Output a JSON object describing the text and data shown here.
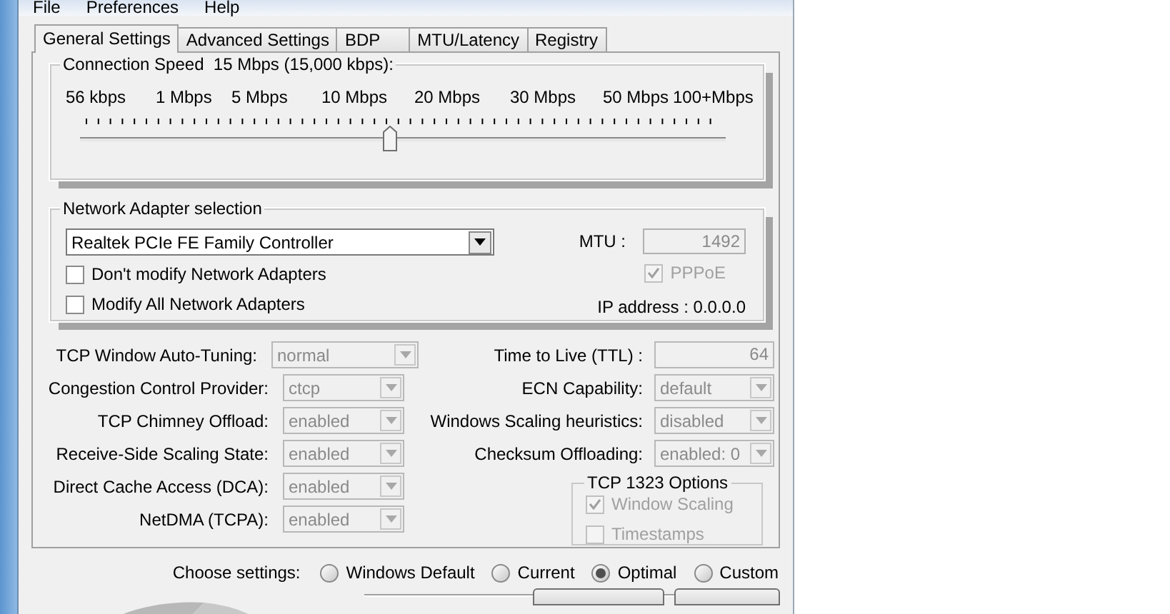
{
  "menu": [
    "File",
    "Preferences",
    "Help"
  ],
  "tabs": [
    {
      "label": "General Settings",
      "selected": true
    },
    {
      "label": "Advanced Settings",
      "selected": false
    },
    {
      "label": "BDP",
      "selected": false
    },
    {
      "label": "MTU/Latency",
      "selected": false
    },
    {
      "label": "Registry",
      "selected": false
    }
  ],
  "connection_speed": {
    "title": "Connection Speed",
    "value": "15 Mbps (15,000 kbps):",
    "scale": [
      "56 kbps",
      "1 Mbps",
      "5 Mbps",
      "10 Mbps",
      "20 Mbps",
      "30 Mbps",
      "50 Mbps",
      "100+Mbps"
    ],
    "level": 0.48
  },
  "adapter": {
    "title": "Network Adapter selection",
    "selected_adapter": "Realtek PCIe FE Family Controller",
    "options": [
      {
        "label": "Don't modify Network Adapters",
        "checked": false
      },
      {
        "label": "Modify All Network Adapters",
        "checked": false
      }
    ],
    "mtu_label": "MTU :",
    "mtu": "1492",
    "pppoe": {
      "label": "PPPoE",
      "checked": true,
      "disabled": true
    },
    "ip_address": "IP address : 0.0.0.0"
  },
  "left_settings": [
    {
      "label": "TCP Window Auto-Tuning:",
      "value": "normal",
      "disabled": true
    },
    {
      "label": "Congestion Control Provider:",
      "value": "ctcp",
      "disabled": true
    },
    {
      "label": "TCP Chimney Offload:",
      "value": "enabled",
      "disabled": true
    },
    {
      "label": "Receive-Side Scaling State:",
      "value": "enabled",
      "disabled": true
    },
    {
      "label": "Direct Cache Access (DCA):",
      "value": "enabled",
      "disabled": true
    },
    {
      "label": "NetDMA (TCPA):",
      "value": "enabled",
      "disabled": true
    }
  ],
  "right_settings": [
    {
      "label": "Time to Live (TTL) :",
      "value": "64",
      "kind": "text",
      "disabled": true
    },
    {
      "label": "ECN Capability:",
      "value": "default",
      "kind": "select",
      "disabled": true
    },
    {
      "label": "Windows Scaling heuristics:",
      "value": "disabled",
      "kind": "select",
      "disabled": true
    },
    {
      "label": "Checksum Offloading:",
      "value": "enabled: 0",
      "kind": "select",
      "disabled": true
    }
  ],
  "tcp1323": {
    "title": "TCP 1323 Options",
    "options": [
      {
        "label": "Window Scaling",
        "checked": true,
        "disabled": true
      },
      {
        "label": "Timestamps",
        "checked": false,
        "disabled": true
      }
    ]
  },
  "choose_settings": {
    "label": "Choose settings:",
    "options": [
      {
        "label": "Windows Default",
        "selected": false
      },
      {
        "label": "Current",
        "selected": false
      },
      {
        "label": "Optimal",
        "selected": true
      },
      {
        "label": "Custom",
        "selected": false
      }
    ]
  }
}
